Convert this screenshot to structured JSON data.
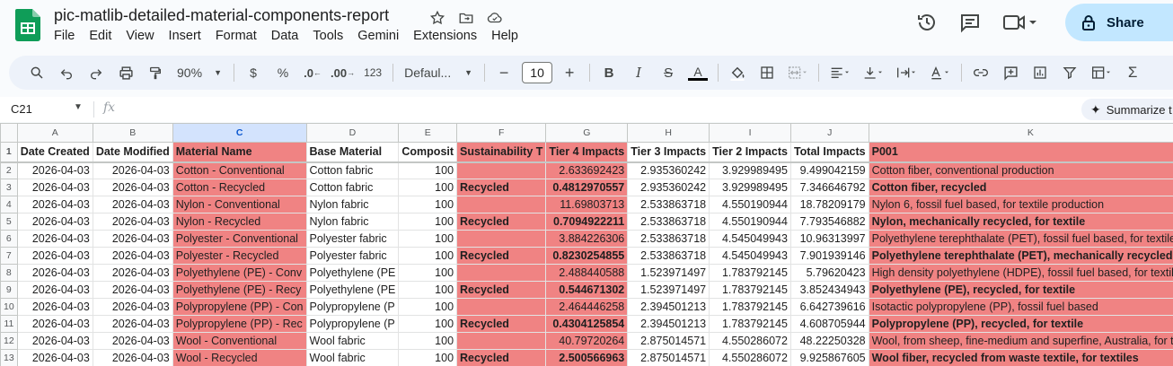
{
  "doc": {
    "title": "pic-matlib-detailed-material-components-report",
    "menu": [
      "File",
      "Edit",
      "View",
      "Insert",
      "Format",
      "Data",
      "Tools",
      "Gemini",
      "Extensions",
      "Help"
    ],
    "share_label": "Share"
  },
  "toolbar": {
    "zoom": "90%",
    "currency": "$",
    "percent": "%",
    "dec_decrease": ".0",
    "dec_increase": ".00",
    "number_format": "123",
    "font": "Defaul...",
    "font_size": "10"
  },
  "formula": {
    "cell_ref": "C21",
    "fx": "fx",
    "summarize_label": "Summarize t"
  },
  "sheet": {
    "col_letters": [
      "A",
      "B",
      "C",
      "D",
      "E",
      "F",
      "G",
      "H",
      "I",
      "J",
      "K"
    ],
    "headers": [
      "Date Created",
      "Date Modified",
      "Material Name",
      "Base Material",
      "Composit",
      "Sustainability T",
      "Tier 4 Impacts",
      "Tier 3 Impacts",
      "Tier 2 Impacts",
      "Total Impacts",
      "P001"
    ],
    "rows": [
      {
        "n": "2",
        "a": "2026-04-03",
        "b": "2026-04-03",
        "c": "Cotton - Conventional",
        "d": "Cotton fabric",
        "e": "100",
        "f": "",
        "g": "2.633692423",
        "h": "2.935360242",
        "i": "3.929989495",
        "j": "9.499042159",
        "k": "Cotton fiber, conventional production",
        "bold": false
      },
      {
        "n": "3",
        "a": "2026-04-03",
        "b": "2026-04-03",
        "c": "Cotton - Recycled",
        "d": "Cotton fabric",
        "e": "100",
        "f": "Recycled",
        "g": "0.4812970557",
        "h": "2.935360242",
        "i": "3.929989495",
        "j": "7.346646792",
        "k": "Cotton fiber, recycled",
        "bold": true
      },
      {
        "n": "4",
        "a": "2026-04-03",
        "b": "2026-04-03",
        "c": "Nylon - Conventional",
        "d": "Nylon fabric",
        "e": "100",
        "f": "",
        "g": "11.69803713",
        "h": "2.533863718",
        "i": "4.550190944",
        "j": "18.78209179",
        "k": "Nylon 6, fossil fuel based, for textile production",
        "bold": false
      },
      {
        "n": "5",
        "a": "2026-04-03",
        "b": "2026-04-03",
        "c": "Nylon - Recycled",
        "d": "Nylon fabric",
        "e": "100",
        "f": "Recycled",
        "g": "0.7094922211",
        "h": "2.533863718",
        "i": "4.550190944",
        "j": "7.793546882",
        "k": "Nylon, mechanically recycled, for textile",
        "bold": true
      },
      {
        "n": "6",
        "a": "2026-04-03",
        "b": "2026-04-03",
        "c": "Polyester - Conventional",
        "d": "Polyester fabric",
        "e": "100",
        "f": "",
        "g": "3.884226306",
        "h": "2.533863718",
        "i": "4.545049943",
        "j": "10.96313997",
        "k": "Polyethylene terephthalate (PET), fossil fuel based, for textile",
        "bold": false
      },
      {
        "n": "7",
        "a": "2026-04-03",
        "b": "2026-04-03",
        "c": "Polyester - Recycled",
        "d": "Polyester fabric",
        "e": "100",
        "f": "Recycled",
        "g": "0.8230254855",
        "h": "2.533863718",
        "i": "4.545049943",
        "j": "7.901939146",
        "k": "Polyethylene terephthalate (PET), mechanically recycled, fo",
        "bold": true
      },
      {
        "n": "8",
        "a": "2026-04-03",
        "b": "2026-04-03",
        "c": "Polyethylene (PE) - Conv",
        "d": "Polyethylene (PE",
        "e": "100",
        "f": "",
        "g": "2.488440588",
        "h": "1.523971497",
        "i": "1.783792145",
        "j": "5.79620423",
        "k": "High density polyethylene (HDPE), fossil fuel based, for textile",
        "bold": false
      },
      {
        "n": "9",
        "a": "2026-04-03",
        "b": "2026-04-03",
        "c": "Polyethylene (PE) - Recy",
        "d": "Polyethylene (PE",
        "e": "100",
        "f": "Recycled",
        "g": "0.544671302",
        "h": "1.523971497",
        "i": "1.783792145",
        "j": "3.852434943",
        "k": "Polyethylene (PE), recycled, for textile",
        "bold": true
      },
      {
        "n": "10",
        "a": "2026-04-03",
        "b": "2026-04-03",
        "c": "Polypropylene (PP) - Con",
        "d": "Polypropylene (P",
        "e": "100",
        "f": "",
        "g": "2.464446258",
        "h": "2.394501213",
        "i": "1.783792145",
        "j": "6.642739616",
        "k": "Isotactic polypropylene (PP), fossil fuel based",
        "bold": false
      },
      {
        "n": "11",
        "a": "2026-04-03",
        "b": "2026-04-03",
        "c": "Polypropylene (PP) - Rec",
        "d": "Polypropylene (P",
        "e": "100",
        "f": "Recycled",
        "g": "0.4304125854",
        "h": "2.394501213",
        "i": "1.783792145",
        "j": "4.608705944",
        "k": "Polypropylene (PP), recycled, for textile",
        "bold": true
      },
      {
        "n": "12",
        "a": "2026-04-03",
        "b": "2026-04-03",
        "c": "Wool - Conventional",
        "d": "Wool fabric",
        "e": "100",
        "f": "",
        "g": "40.79720264",
        "h": "2.875014571",
        "i": "4.550286072",
        "j": "48.22250328",
        "k": "Wool, from sheep, fine-medium and superfine, Australia, for text",
        "bold": false
      },
      {
        "n": "13",
        "a": "2026-04-03",
        "b": "2026-04-03",
        "c": "Wool - Recycled",
        "d": "Wool fabric",
        "e": "100",
        "f": "Recycled",
        "g": "2.500566963",
        "h": "2.875014571",
        "i": "4.550286072",
        "j": "9.925867605",
        "k": "Wool fiber, recycled from waste textile, for textiles",
        "bold": true
      }
    ],
    "header_row_num": "1",
    "highlight_color": "#f08383"
  }
}
